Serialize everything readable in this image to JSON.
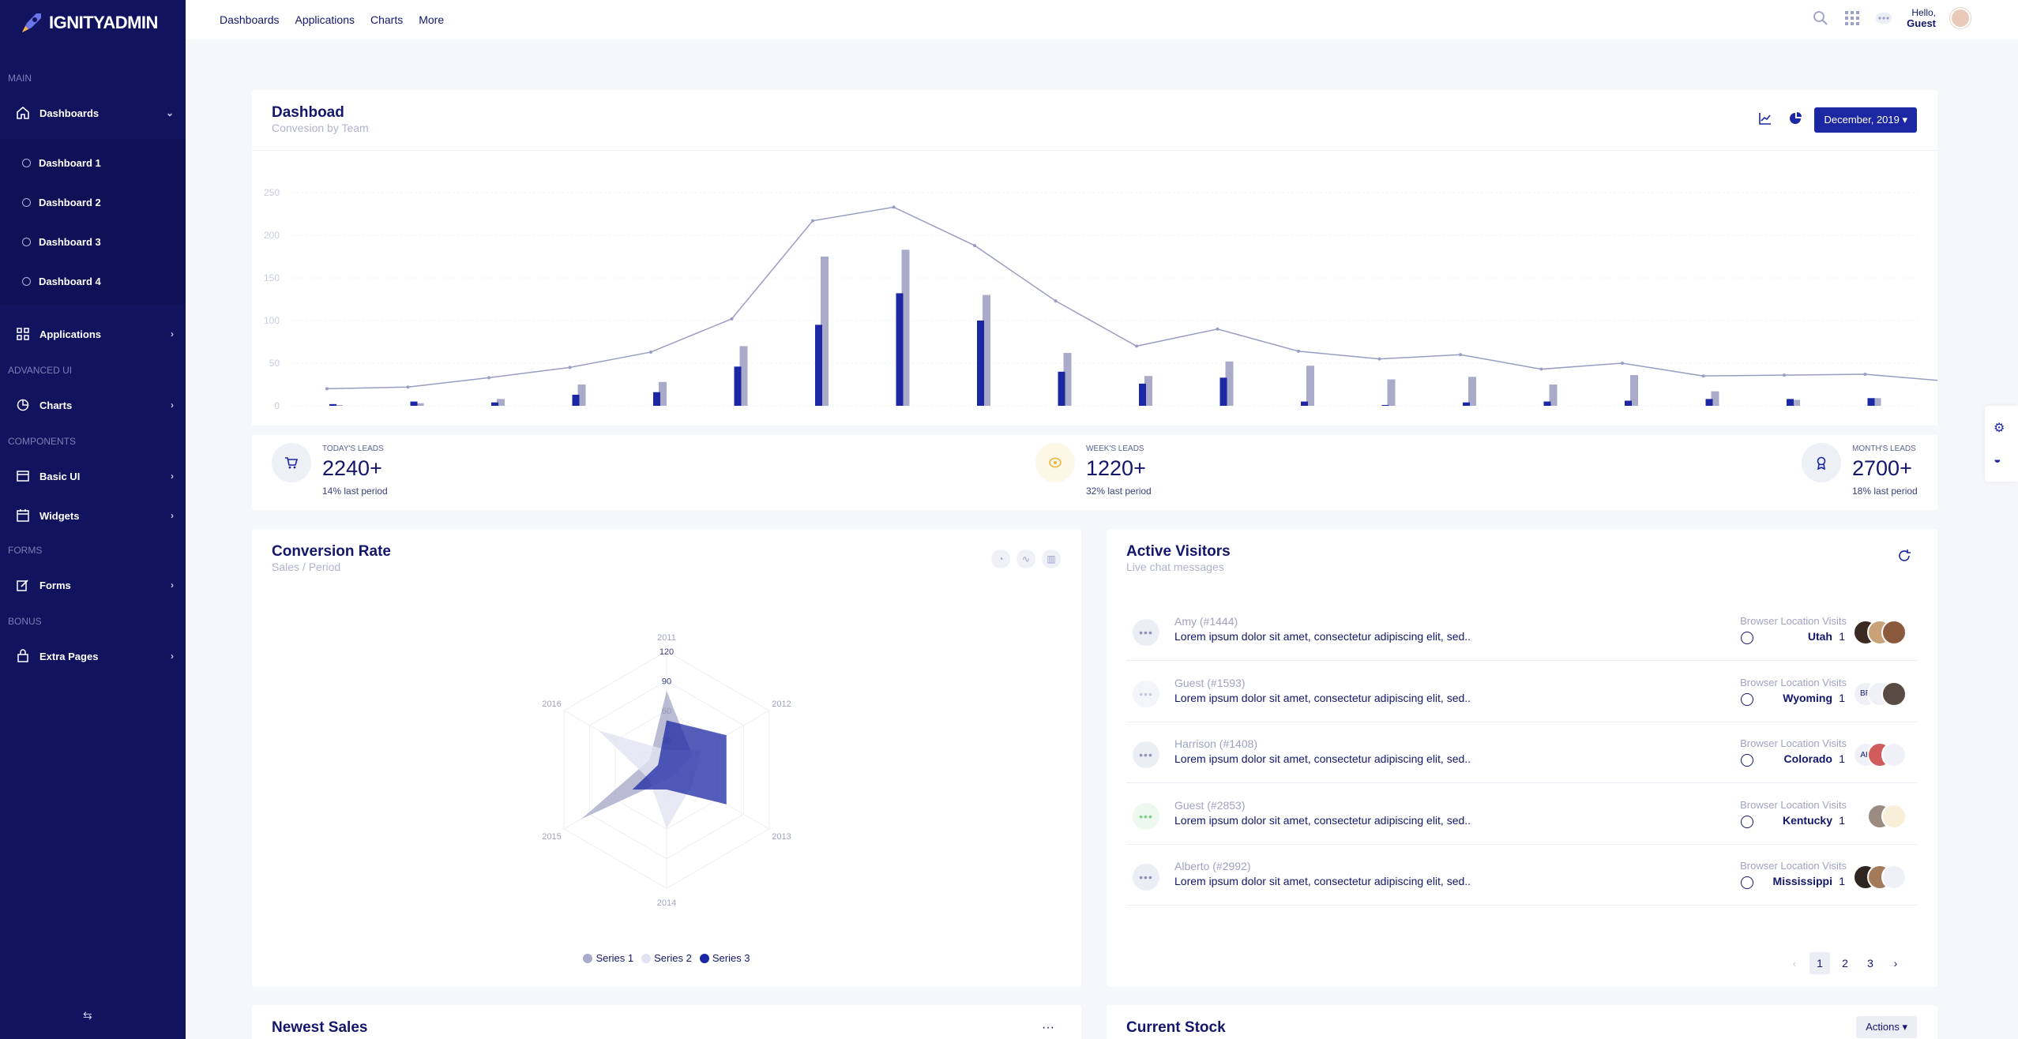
{
  "brand": {
    "name": "IGNITYADMIN"
  },
  "colors": {
    "sidebar": "#12135e",
    "accent": "#1b27a3",
    "light_series": "#a9abc9",
    "line": "#9a9dc2"
  },
  "sidebar": {
    "sections": {
      "main": "MAIN",
      "advanced_ui": "ADVANCED UI",
      "components": "COMPONENTS",
      "forms": "FORMS",
      "bonus": "BONUS"
    },
    "dashboards": "Dashboards",
    "sub_items": [
      "Dashboard 1",
      "Dashboard 2",
      "Dashboard 3",
      "Dashboard 4"
    ],
    "applications": "Applications",
    "charts": "Charts",
    "basic_ui": "Basic UI",
    "widgets": "Widgets",
    "forms": "Forms",
    "extra_pages": "Extra Pages"
  },
  "topnav": [
    "Dashboards",
    "Applications",
    "Charts",
    "More"
  ],
  "user": {
    "hello": "Hello,",
    "name": "Guest"
  },
  "dashboard": {
    "title": "Dashboad",
    "subtitle": "Convesion by Team",
    "month_button": "December, 2019 ▾"
  },
  "chart_data": {
    "type": "bar",
    "y_ticks": [
      "250",
      "200",
      "150",
      "100",
      "50",
      "0"
    ],
    "ylim": [
      0,
      250
    ],
    "grid": true,
    "series": [
      {
        "values": [
          1,
          3,
          8,
          25,
          28,
          70,
          175,
          183,
          130,
          62,
          35,
          52,
          47,
          31,
          34,
          25,
          36,
          17,
          7,
          9
        ]
      },
      {
        "values": [
          2,
          5,
          4,
          13,
          16,
          46,
          95,
          132,
          100,
          40,
          26,
          33,
          5,
          1,
          4,
          5,
          6,
          8,
          8,
          9
        ]
      },
      {
        "values": [
          20,
          22,
          33,
          45,
          63,
          102,
          217,
          233,
          188,
          123,
          70,
          90,
          64,
          55,
          60,
          43,
          50,
          35,
          36,
          37,
          29
        ]
      }
    ]
  },
  "leads": [
    {
      "label": "Today's Leads",
      "value": "2240+",
      "period": "14% last period",
      "icon": "cart-icon",
      "bg": "#eef0f8",
      "fg": "#1b27a3"
    },
    {
      "label": "Week's Leads",
      "value": "1220+",
      "period": "32% last period",
      "icon": "coin-icon",
      "bg": "#fdf7e8",
      "fg": "#e7b53c"
    },
    {
      "label": "Month's Leads",
      "value": "2700+",
      "period": "18% last period",
      "icon": "badge-icon",
      "bg": "#eef0f8",
      "fg": "#1b27a3"
    }
  ],
  "conversion": {
    "title": "Conversion Rate",
    "subtitle": "Sales / Period",
    "legend": [
      "Series 1",
      "Series 2",
      "Series 3"
    ]
  },
  "radar_data": {
    "type": "radar",
    "axes": [
      "2011",
      "2012",
      "2013",
      "2014",
      "2015",
      "2016"
    ],
    "ticks": [
      "120",
      "90",
      "60",
      "30",
      "0"
    ],
    "max": 120,
    "series": [
      {
        "name": "Series 1",
        "values": [
          80,
          30,
          10,
          10,
          100,
          20
        ],
        "color": "#a9abc9"
      },
      {
        "name": "Series 2",
        "values": [
          20,
          40,
          30,
          60,
          20,
          80
        ],
        "color": "#e2e3f1"
      },
      {
        "name": "Series 3",
        "values": [
          50,
          70,
          70,
          20,
          40,
          10
        ],
        "color": "#1b27a3"
      }
    ]
  },
  "visitors": {
    "title": "Active Visitors",
    "subtitle": "Live chat messages",
    "head": "Browser Location Visits",
    "rows": [
      {
        "name": "Amy (#1444)",
        "message": "Lorem ipsum dolor sit amet, consectetur adipiscing elit, sed..",
        "location": "Utah",
        "visits": "1",
        "bubble": "#eceef6",
        "bubble_fg": "#8f93bd"
      },
      {
        "name": "Guest (#1593)",
        "message": "Lorem ipsum dolor sit amet, consectetur adipiscing elit, sed..",
        "location": "Wyoming",
        "visits": "1",
        "bubble": "#f4f5fa",
        "bubble_fg": "#c6c9df"
      },
      {
        "name": "Harrison (#1408)",
        "message": "Lorem ipsum dolor sit amet, consectetur adipiscing elit, sed..",
        "location": "Colorado",
        "visits": "1",
        "bubble": "#eceef6",
        "bubble_fg": "#8f93bd"
      },
      {
        "name": "Guest (#2853)",
        "message": "Lorem ipsum dolor sit amet, consectetur adipiscing elit, sed..",
        "location": "Kentucky",
        "visits": "1",
        "bubble": "#edf8ef",
        "bubble_fg": "#7bd18c"
      },
      {
        "name": "Alberto (#2992)",
        "message": "Lorem ipsum dolor sit amet, consectetur adipiscing elit, sed..",
        "location": "Mississippi",
        "visits": "1",
        "bubble": "#eceef6",
        "bubble_fg": "#8f93bd"
      }
    ],
    "avatar_initials": {
      "br": "BR",
      "ak": "AK"
    },
    "pages": [
      "1",
      "2",
      "3"
    ]
  },
  "newest_sales": {
    "title": "Newest Sales"
  },
  "current_stock": {
    "title": "Current Stock",
    "actions": "Actions ▾"
  }
}
